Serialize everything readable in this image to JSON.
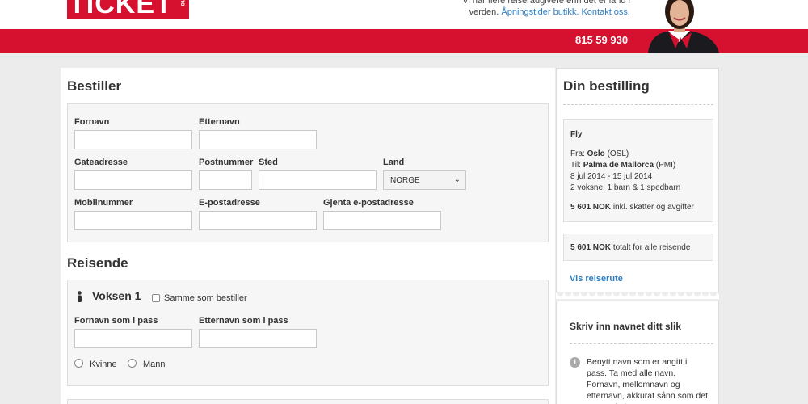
{
  "header": {
    "logo_text": "TICKET",
    "logo_sub": "no",
    "info_line1": "Vi har flere reiserådgivere enn det er land i",
    "info_prefix": "verden.",
    "link_hours": "Åpningstider butikk.",
    "link_contact": "Kontakt oss.",
    "phone": "815 59 930"
  },
  "bestiller": {
    "title": "Bestiller",
    "fornavn": "Fornavn",
    "etternavn": "Etternavn",
    "gateadresse": "Gateadresse",
    "postnummer": "Postnummer",
    "sted": "Sted",
    "land": "Land",
    "land_value": "NORGE",
    "mobilnummer": "Mobilnummer",
    "epost": "E-postadresse",
    "gjenta_epost": "Gjenta e-postadresse"
  },
  "reisende": {
    "title": "Reisende",
    "voksen_label": "Voksen 1",
    "same_as_label": "Samme som bestiller",
    "fornavn_pass": "Fornavn som i pass",
    "etternavn_pass": "Etternavn som i pass",
    "kvinne": "Kvinne",
    "mann": "Mann"
  },
  "bestilling": {
    "title": "Din bestilling",
    "type": "Fly",
    "fra_prefix": "Fra:",
    "fra_city": "Oslo",
    "fra_code": "(OSL)",
    "til_prefix": "Til:",
    "til_city": "Palma de Mallorca",
    "til_code": "(PMI)",
    "dates": "8 jul 2014 - 15 jul 2014",
    "passengers": "2 voksne, 1 barn & 1 spedbarn",
    "price": "5 601 NOK",
    "price_note": "inkl. skatter og avgifter",
    "total_price": "5 601 NOK",
    "total_note": "totalt for alle reisende",
    "link": "Vis reiserute"
  },
  "namehint": {
    "title": "Skriv inn navnet ditt slik",
    "step": "1",
    "text": "Benytt navn som er angitt i pass. Ta med alle navn. Fornavn, mellomnavn og etternavn, akkurat sånn som det er oppgitt i"
  },
  "colors": {
    "brand_red": "#d6102f",
    "link_blue": "#2d7dc2"
  }
}
